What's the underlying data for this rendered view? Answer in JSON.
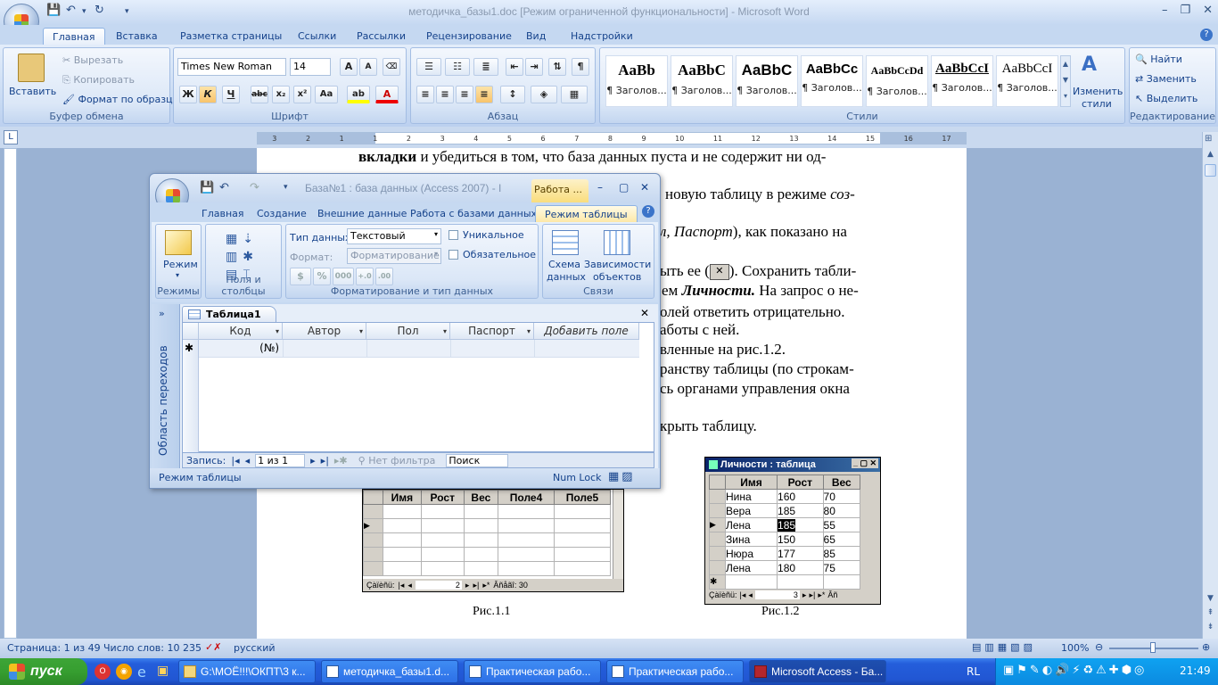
{
  "word": {
    "title": "методичка_базы1.doc [Режим ограниченной функциональности] - Microsoft Word",
    "tabs": [
      "Главная",
      "Вставка",
      "Разметка страницы",
      "Ссылки",
      "Рассылки",
      "Рецензирование",
      "Вид",
      "Надстройки"
    ],
    "clipboard": {
      "paste": "Вставить",
      "cut": "Вырезать",
      "copy": "Копировать",
      "format_painter": "Формат по образцу",
      "label": "Буфер обмена"
    },
    "font": {
      "name": "Times New Roman",
      "size": "14",
      "label": "Шрифт"
    },
    "paragraph_label": "Абзац",
    "styles": {
      "items": [
        {
          "sample": "AaBb",
          "name": "¶ Заголов..."
        },
        {
          "sample": "AaBbC",
          "name": "¶ Заголов..."
        },
        {
          "sample": "AaBbC",
          "name": "¶ Заголов..."
        },
        {
          "sample": "AaBbCc",
          "name": "¶ Заголов..."
        },
        {
          "sample": "AaBbCcDd",
          "name": "¶ Заголов..."
        },
        {
          "sample": "AaBbCcI",
          "name": "¶ Заголов..."
        },
        {
          "sample": "AaBbCcI",
          "name": "¶ Заголов..."
        }
      ],
      "change_l1": "Изменить",
      "change_l2": "стили",
      "label": "Стили"
    },
    "editing": {
      "find": "Найти",
      "replace": "Заменить",
      "select": "Выделить",
      "label": "Редактирование"
    },
    "ruler": [
      "3",
      "2",
      "1",
      "1",
      "2",
      "3",
      "4",
      "5",
      "6",
      "7",
      "8",
      "9",
      "10",
      "11",
      "12",
      "13",
      "14",
      "15",
      "16",
      "17"
    ],
    "doc_lines": {
      "l1a": "вкладки",
      "l1b": " и убедиться в том, что база данных пуста и не содержит ни од-",
      "l2": "новую таблицу в режиме ",
      "l2i": "соз-",
      "l3": "л, Паспорт",
      "l3b": "), как показано на",
      "l4a": "ыть ее (",
      "l4b": "). Сохранить табли-",
      "l5a": "ем ",
      "l5b": "Личности.",
      "l5c": " На запрос о не-",
      "l6": "олей ответить отрицательно.",
      "l7": "аботы с ней.",
      "l8": "вленные на рис.1.2.",
      "l9": "ранству таблицы (по строкам-",
      "l10": "сь органами управления окна",
      "l11": "крыть таблицу."
    },
    "fig1": {
      "headers": [
        "Имя",
        "Рост",
        "Вес",
        "Поле4",
        "Поле5"
      ],
      "nav_label": "Çàïèñü:",
      "nav_pos": "2",
      "nav_of": "Âñåãî: 30",
      "caption": "Рис.1.1"
    },
    "fig2": {
      "title": "Личности : таблица",
      "headers": [
        "Имя",
        "Рост",
        "Вес"
      ],
      "rows": [
        [
          "Нина",
          "160",
          "70"
        ],
        [
          "Вера",
          "185",
          "80"
        ],
        [
          "Лена",
          "185",
          "55"
        ],
        [
          "Зина",
          "150",
          "65"
        ],
        [
          "Нюра",
          "177",
          "85"
        ],
        [
          "Лена",
          "180",
          "75"
        ]
      ],
      "nav_label": "Çàïèñü:",
      "nav_pos": "3",
      "nav_of": "Âñ",
      "caption": "Рис.1.2"
    },
    "status": {
      "page": "Страница: 1 из 49",
      "words": "Число слов: 10 235",
      "lang": "русский",
      "zoom": "100%"
    }
  },
  "access": {
    "title": "База№1 : база данных (Access 2007) - I",
    "context_tab": "Работа ...",
    "tabs": [
      "Главная",
      "Создание",
      "Внешние данные",
      "Работа с базами данных",
      "Режим таблицы"
    ],
    "ribbon": {
      "view": "Режим",
      "views_label": "Режимы",
      "fields_label": "Поля и столбцы",
      "datatype_label": "Тип данных:",
      "datatype_value": "Текстовый",
      "format_label": "Формат:",
      "format_value": "Форматирование",
      "unique": "Уникальное",
      "required": "Обязательное",
      "format_group_label": "Форматирование и тип данных",
      "schema_l1": "Схема",
      "schema_l2": "данных",
      "deps_l1": "Зависимости",
      "deps_l2": "объектов",
      "relations_label": "Связи",
      "percent": "%",
      "thousands": "000"
    },
    "nav_pane": "Область переходов",
    "table_tab": "Таблица1",
    "columns": [
      "Код",
      "Автор",
      "Пол",
      "Паспорт",
      "Добавить поле"
    ],
    "new_row": "(№)",
    "record_nav": {
      "label": "Запись:",
      "position": "1 из 1",
      "filter": "Нет фильтра",
      "search": "Поиск"
    },
    "status": {
      "mode": "Режим таблицы",
      "numlock": "Num Lock"
    }
  },
  "taskbar": {
    "start": "пуск",
    "buttons": [
      "G:\\МОЁ!!!\\ОКПТ\\3 к...",
      "методичка_базы1.d...",
      "Практическая рабо...",
      "Практическая рабо...",
      "Microsoft Access - Ба..."
    ],
    "lang": "RL",
    "clock": "21:49"
  }
}
